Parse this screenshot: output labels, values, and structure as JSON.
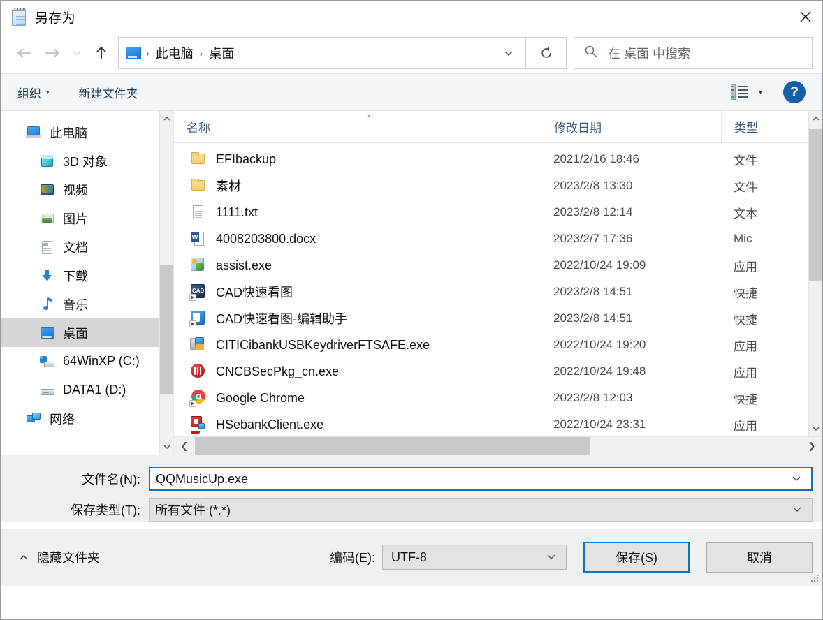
{
  "window": {
    "title": "另存为",
    "icon": "notepad-icon",
    "close_label": "✕"
  },
  "nav": {
    "back": "←",
    "forward": "→",
    "history": "⌄",
    "up": "↑",
    "breadcrumb": [
      "此电脑",
      "桌面"
    ],
    "breadcrumb_separator": "›",
    "address_chevron": "⌄",
    "refresh": "↻"
  },
  "search": {
    "placeholder": "在 桌面 中搜索",
    "icon": "search-icon"
  },
  "toolbar": {
    "organize": "组织",
    "organize_caret": "▾",
    "new_folder": "新建文件夹",
    "view_caret": "▾",
    "help": "?"
  },
  "sidebar": {
    "items": [
      {
        "label": "此电脑",
        "level": 0,
        "icon": "computer-icon",
        "selected": false
      },
      {
        "label": "3D 对象",
        "level": 1,
        "icon": "3d-objects-icon",
        "selected": false
      },
      {
        "label": "视频",
        "level": 1,
        "icon": "videos-icon",
        "selected": false
      },
      {
        "label": "图片",
        "level": 1,
        "icon": "pictures-icon",
        "selected": false
      },
      {
        "label": "文档",
        "level": 1,
        "icon": "documents-icon",
        "selected": false
      },
      {
        "label": "下载",
        "level": 1,
        "icon": "downloads-icon",
        "selected": false
      },
      {
        "label": "音乐",
        "level": 1,
        "icon": "music-icon",
        "selected": false
      },
      {
        "label": "桌面",
        "level": 1,
        "icon": "desktop-icon",
        "selected": true
      },
      {
        "label": "64WinXP  (C:)",
        "level": 1,
        "icon": "windows-drive-icon",
        "selected": false
      },
      {
        "label": "DATA1 (D:)",
        "level": 1,
        "icon": "drive-icon",
        "selected": false
      },
      {
        "label": "网络",
        "level": 0,
        "icon": "network-icon",
        "selected": false
      }
    ]
  },
  "filelist": {
    "columns": [
      "名称",
      "修改日期",
      "类型"
    ],
    "sort_indicator": "⌃",
    "rows": [
      {
        "name": "EFIbackup",
        "date": "2021/2/16 18:46",
        "type": "文件",
        "icon": "folder-icon"
      },
      {
        "name": "素材",
        "date": "2023/2/8 13:30",
        "type": "文件",
        "icon": "folder-icon"
      },
      {
        "name": "1111.txt",
        "date": "2023/2/8 12:14",
        "type": "文本",
        "icon": "text-file-icon"
      },
      {
        "name": "4008203800.docx",
        "date": "2023/2/7 17:36",
        "type": "Mic",
        "icon": "word-file-icon"
      },
      {
        "name": "assist.exe",
        "date": "2022/10/24 19:09",
        "type": "应用",
        "icon": "assist-exe-icon"
      },
      {
        "name": "CAD快速看图",
        "date": "2023/2/8 14:51",
        "type": "快捷",
        "icon": "cad-shortcut-icon"
      },
      {
        "name": "CAD快速看图-编辑助手",
        "date": "2023/2/8 14:51",
        "type": "快捷",
        "icon": "cad-editor-shortcut-icon"
      },
      {
        "name": "CITICibankUSBKeydriverFTSAFE.exe",
        "date": "2022/10/24 19:20",
        "type": "应用",
        "icon": "installer-icon"
      },
      {
        "name": "CNCBSecPkg_cn.exe",
        "date": "2022/10/24 19:48",
        "type": "应用",
        "icon": "cncb-icon"
      },
      {
        "name": "Google Chrome",
        "date": "2023/2/8 12:03",
        "type": "快捷",
        "icon": "chrome-icon"
      },
      {
        "name": "HSebankClient.exe",
        "date": "2022/10/24 23:31",
        "type": "应用",
        "icon": "hsebank-icon"
      }
    ],
    "hscroll": {
      "left_arrow": "❮",
      "right_arrow": "❯"
    }
  },
  "form": {
    "filename_label": "文件名(N):",
    "filename_value": "QQMusicUp.exe",
    "filetype_label": "保存类型(T):",
    "filetype_value": "所有文件  (*.*)",
    "combo_caret": "⌄"
  },
  "footer": {
    "hide_folders_caret": "⌃",
    "hide_folders": "隐藏文件夹",
    "encoding_label": "编码(E):",
    "encoding_value": "UTF-8",
    "save_button": "保存(S)",
    "cancel_button": "取消"
  },
  "colors": {
    "accent": "#0a72c8",
    "selection": "#d6d6d6",
    "header_text": "#3d5a80"
  }
}
